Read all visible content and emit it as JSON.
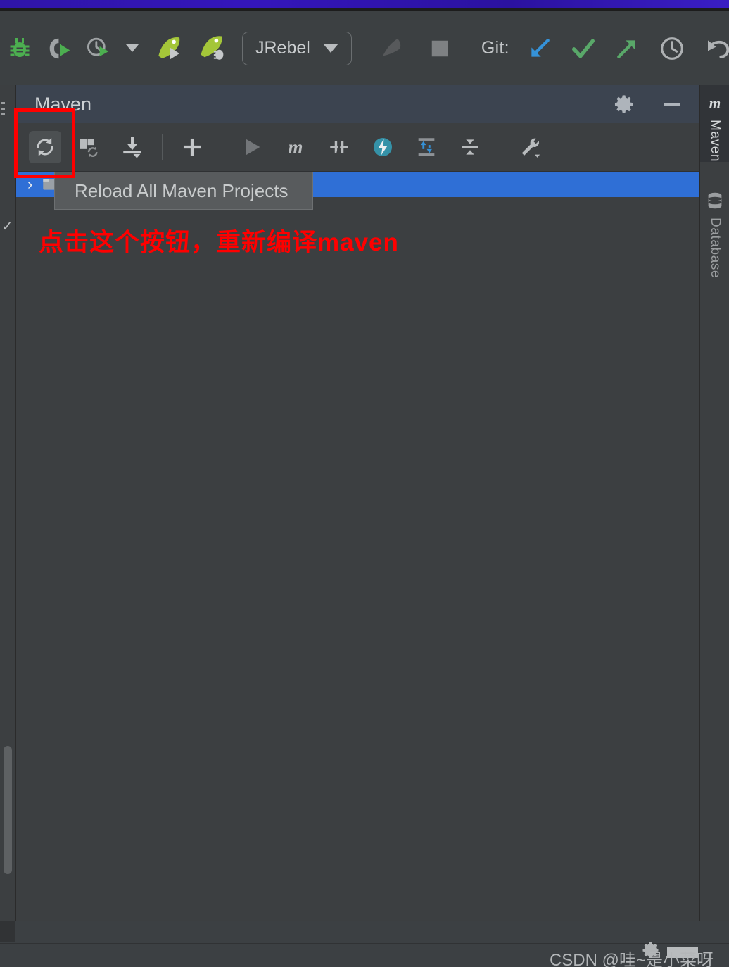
{
  "window": {
    "accent_color": "#3416bb",
    "background": "#3c3f41"
  },
  "main_toolbar": {
    "items": [
      {
        "name": "debug-bug-icon",
        "label": "",
        "icon": "bug"
      },
      {
        "name": "run-with-coverage-icon",
        "label": "",
        "icon": "coverage"
      },
      {
        "name": "profiler-icon",
        "label": "",
        "icon": "profiler"
      },
      {
        "name": "profiler-dropdown-caret",
        "label": "",
        "icon": "caret-down"
      },
      {
        "name": "jrebel-run-icon",
        "label": "",
        "icon": "jrebel-run"
      },
      {
        "name": "jrebel-debug-icon",
        "label": "",
        "icon": "jrebel-debug"
      }
    ],
    "jrebel_button": {
      "label": "JRebel",
      "name": "jrebel-dropdown-button"
    },
    "stop_icon": "stop-icon",
    "hammer_icon": "build-hammer-icon",
    "git_label": "Git:",
    "git_items": [
      {
        "name": "git-update-project-icon",
        "color": "#3592d8"
      },
      {
        "name": "git-commit-icon",
        "color": "#59a869"
      },
      {
        "name": "git-push-icon",
        "color": "#59a869"
      },
      {
        "name": "git-history-icon",
        "color": "#aeb1b3"
      },
      {
        "name": "git-rollback-icon",
        "color": "#aeb1b3"
      }
    ],
    "search_icon": "search-icon",
    "settings_icon": "gear-icon",
    "product_icon": "idea-logo-icon"
  },
  "tool_window": {
    "title": "Maven",
    "header_actions": [
      {
        "name": "maven-settings-gear-icon"
      },
      {
        "name": "hide-tool-window-icon"
      }
    ],
    "toolbar": [
      {
        "name": "reload-all-maven-projects-button",
        "icon": "reload",
        "pressed": true
      },
      {
        "name": "generate-sources-and-update-folders-button",
        "icon": "generate-sources"
      },
      {
        "name": "download-sources-and-documentation-button",
        "icon": "download"
      },
      {
        "name": "add-maven-project-button",
        "icon": "plus"
      },
      {
        "name": "run-maven-build-button",
        "icon": "play"
      },
      {
        "name": "execute-maven-goal-button",
        "icon": "m-goal"
      },
      {
        "name": "toggle-skip-tests-button",
        "icon": "skip-tests"
      },
      {
        "name": "toggle-offline-mode-button",
        "icon": "offline-bolt"
      },
      {
        "name": "expand-all-button",
        "icon": "expand-all"
      },
      {
        "name": "collapse-all-button",
        "icon": "collapse-all"
      },
      {
        "name": "maven-settings-wrench-button",
        "icon": "wrench"
      }
    ],
    "tree": {
      "selected_row": {
        "name": "maven-project-row",
        "arrow": "›",
        "label": ""
      },
      "selection_color": "#2f6fd6"
    }
  },
  "tooltip": {
    "text": "Reload All Maven Projects",
    "name": "reload-all-maven-projects-tooltip"
  },
  "annotation": {
    "note": "点击这个按钮，重新编译maven",
    "color": "#ff0000"
  },
  "right_tool_strip": {
    "items": [
      {
        "name": "tool-strip-maven",
        "label": "Maven",
        "icon": "maven-m-icon",
        "active": true
      },
      {
        "name": "tool-strip-database",
        "label": "Database",
        "icon": "database-icon",
        "active": false
      }
    ]
  },
  "status_bar": {
    "gear_icon": "status-gear-icon",
    "watermark": "CSDN @哇~是小菜呀"
  }
}
